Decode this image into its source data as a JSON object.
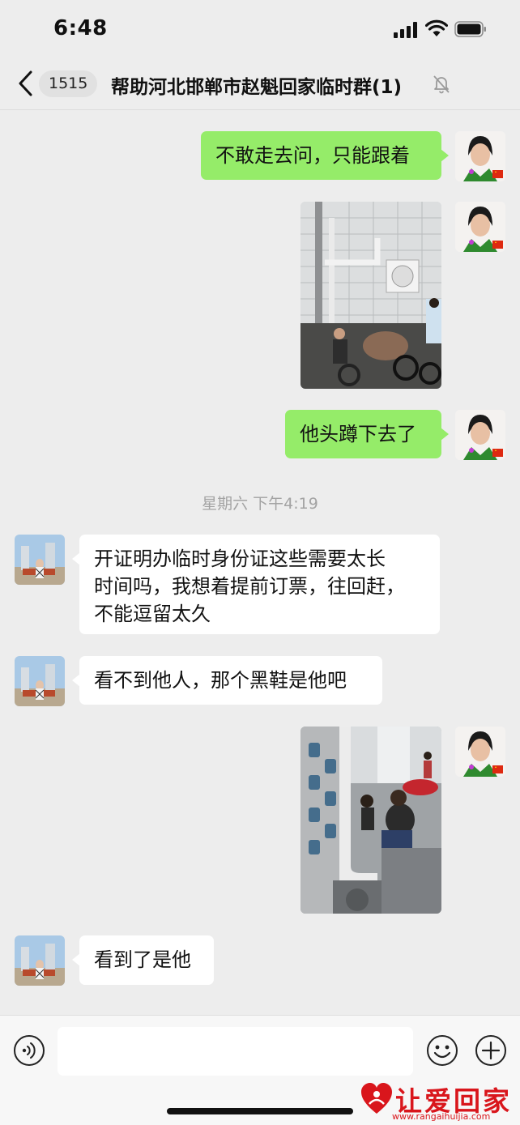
{
  "status_bar": {
    "time": "6:48"
  },
  "nav": {
    "unread_count": "1515",
    "title": "帮助河北邯郸市赵魁回家临时群(1)"
  },
  "messages": [
    {
      "sender": "me",
      "type": "text",
      "text": "不敢走去问，只能跟着"
    },
    {
      "sender": "me",
      "type": "image",
      "image_desc": "street scene with pipes and parked bicycles"
    },
    {
      "sender": "me",
      "type": "text",
      "text": "他头蹲下去了"
    },
    {
      "type": "timestamp",
      "text": "星期六 下午4:19"
    },
    {
      "sender": "other",
      "type": "text",
      "lines": [
        "开证明办临时身份证这些需要太长",
        "时间吗，我想着提前订票，往回赶，",
        "不能逗留太久"
      ]
    },
    {
      "sender": "other",
      "type": "text",
      "text": "看不到他人，那个黑鞋是他吧"
    },
    {
      "sender": "me",
      "type": "image",
      "image_desc": "alley with water meters and a crouching man"
    },
    {
      "sender": "other",
      "type": "text",
      "text": "看到了是他"
    }
  ],
  "input_bar": {
    "placeholder": ""
  },
  "watermark": {
    "brand": "让爱回家",
    "url": "www.rangaihuijia.com"
  },
  "colors": {
    "my_bubble": "#95ec69",
    "other_bubble": "#ffffff",
    "background": "#ededed",
    "watermark": "#d9161c"
  },
  "icons": [
    "back-icon",
    "mute-icon",
    "voice-icon",
    "emoji-icon",
    "plus-icon",
    "signal-icon",
    "wifi-icon",
    "battery-icon"
  ]
}
